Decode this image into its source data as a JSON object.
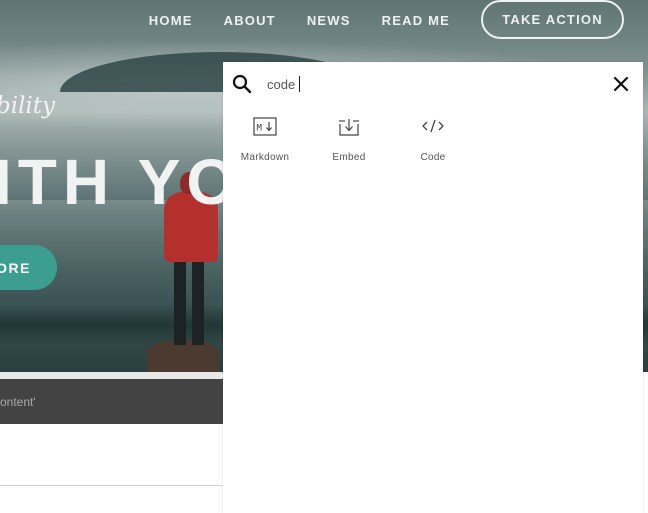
{
  "nav": {
    "links": [
      "HOME",
      "ABOUT",
      "NEWS",
      "READ ME"
    ],
    "cta_label": "TAKE ACTION"
  },
  "hero": {
    "script_text": "bility",
    "title": "ITH YO",
    "button_label": "ORE"
  },
  "content_bar": {
    "text": "ontent'"
  },
  "search_panel": {
    "query": "code",
    "results": [
      {
        "label": "Markdown",
        "icon": "markdown-icon"
      },
      {
        "label": "Embed",
        "icon": "embed-icon"
      },
      {
        "label": "Code",
        "icon": "code-icon"
      }
    ]
  }
}
